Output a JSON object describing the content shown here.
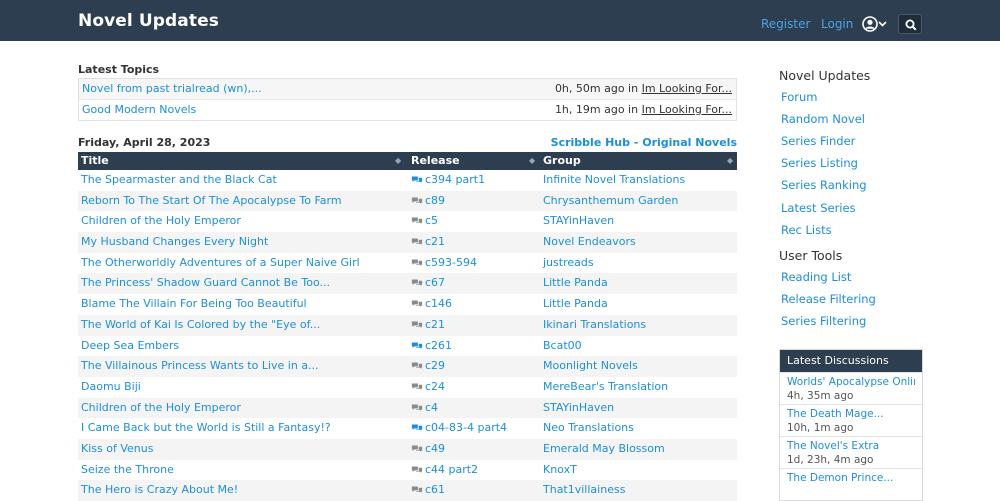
{
  "header": {
    "brand": "Novel Updates",
    "register": "Register",
    "login": "Login"
  },
  "latest_topics": {
    "title": "Latest Topics",
    "rows": [
      {
        "title": "Novel from past trialread (wn),...",
        "time": "0h, 50m ago in",
        "forum": "Im Looking For..."
      },
      {
        "title": "Good Modern Novels",
        "time": "1h, 19m ago in",
        "forum": "Im Looking For..."
      }
    ]
  },
  "releases": {
    "date": "Friday, April 28, 2023",
    "sponsor": "Scribble Hub - Original Novels",
    "columns": [
      "Title",
      "Release",
      "Group"
    ],
    "rows": [
      {
        "title": "The Spearmaster and the Black Cat",
        "release": "c394 part1",
        "group": "Infinite Novel Translations",
        "icon": "chat-filled-icon"
      },
      {
        "title": "Reborn To The Start Of The Apocalypse To Farm",
        "release": "c89",
        "group": "Chrysanthemum Garden",
        "icon": "chat-icon"
      },
      {
        "title": "Children of the Holy Emperor",
        "release": "c5",
        "group": "STAYinHaven",
        "icon": "chat-icon"
      },
      {
        "title": "My Husband Changes Every Night",
        "release": "c21",
        "group": "Novel Endeavors",
        "icon": "chat-icon"
      },
      {
        "title": "The Otherworldly Adventures of a Super Naive Girl",
        "release": "c593-594",
        "group": "justreads",
        "icon": "chat-icon"
      },
      {
        "title": "The Princess' Shadow Guard Cannot Be Too...",
        "release": "c67",
        "group": "Little Panda",
        "icon": "chat-icon"
      },
      {
        "title": "Blame The Villain For Being Too Beautiful",
        "release": "c146",
        "group": "Little Panda",
        "icon": "chat-icon"
      },
      {
        "title": "The World of Kai Is Colored by the \"Eye of...",
        "release": "c21",
        "group": "Ikinari Translations",
        "icon": "chat-icon"
      },
      {
        "title": "Deep Sea Embers",
        "release": "c261",
        "group": "Bcat00",
        "icon": "chat-filled-icon"
      },
      {
        "title": "The Villainous Princess Wants to Live in a...",
        "release": "c29",
        "group": "Moonlight Novels",
        "icon": "chat-icon"
      },
      {
        "title": "Daomu Biji",
        "release": "c24",
        "group": "MereBear's Translation",
        "icon": "chat-icon"
      },
      {
        "title": "Children of the Holy Emperor",
        "release": "c4",
        "group": "STAYinHaven",
        "icon": "chat-icon"
      },
      {
        "title": "I Came Back but the World is Still a Fantasy!?",
        "release": "c04-83-4 part4",
        "group": "Neo Translations",
        "icon": "chat-filled-icon"
      },
      {
        "title": "Kiss of Venus",
        "release": "c49",
        "group": "Emerald May Blossom",
        "icon": "chat-icon"
      },
      {
        "title": "Seize the Throne",
        "release": "c44 part2",
        "group": "KnoxT",
        "icon": "chat-icon"
      },
      {
        "title": "The Hero is Crazy About Me!",
        "release": "c61",
        "group": "That1villainess",
        "icon": "chat-icon"
      }
    ]
  },
  "sidebar": {
    "novel_updates": {
      "title": "Novel Updates",
      "links": [
        "Forum",
        "Random Novel",
        "Series Finder",
        "Series Listing",
        "Series Ranking",
        "Latest Series",
        "Rec Lists"
      ]
    },
    "user_tools": {
      "title": "User Tools",
      "links": [
        "Reading List",
        "Release Filtering",
        "Series Filtering"
      ]
    },
    "discussions": {
      "title": "Latest Discussions",
      "items": [
        {
          "title": "Worlds' Apocalypse Online",
          "time": "4h, 35m ago"
        },
        {
          "title": "The Death Mage...",
          "time": "10h, 1m ago"
        },
        {
          "title": "The Novel's Extra",
          "time": "1d, 23h, 4m ago"
        },
        {
          "title": "The Demon Prince...",
          "time": ""
        }
      ]
    }
  },
  "colors": {
    "header_bg": "#2d3e50",
    "link": "#1d8fd6",
    "nav_link": "#4aa3e8"
  }
}
